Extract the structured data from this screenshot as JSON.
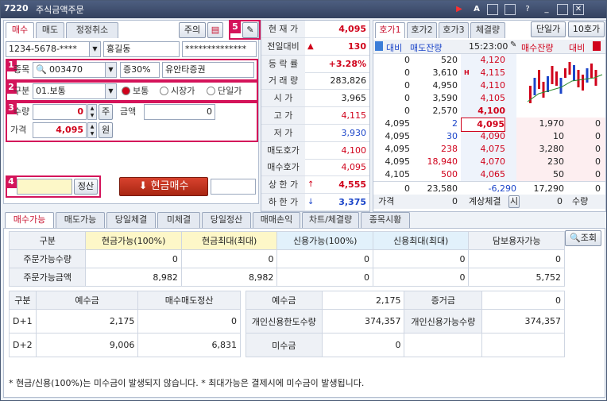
{
  "window": {
    "code": "7220",
    "title": "주식금액주문"
  },
  "left": {
    "tabs": [
      "매수",
      "매도",
      "정정취소"
    ],
    "btn_notice": "주의",
    "account": "1234-5678-****",
    "account_name": "홍길동",
    "password": "**************",
    "stock_label": "종목",
    "stock_code": "003470",
    "margin": "증30%",
    "stock_name": "유안타증권",
    "type_label": "구분",
    "order_type": "01.보통",
    "radio": [
      "보통",
      "시장가",
      "단일가"
    ],
    "qty_label": "수량",
    "qty": "0",
    "qty_btn": "주",
    "amt_label": "금액",
    "amt": "0",
    "price_label": "가격",
    "price": "4,095",
    "price_btn": "원",
    "calc_btn": "정산",
    "buy_btn": "현금매수",
    "markers": [
      "1",
      "2",
      "3",
      "4",
      "5"
    ]
  },
  "quote": [
    {
      "k": "현 재 가",
      "v": "4,095"
    },
    {
      "k": "전일대비",
      "v": "130",
      "arrow": "▲"
    },
    {
      "k": "등 락 률",
      "v": "+3.28%"
    },
    {
      "k": "거 래 량",
      "v": "283,826"
    },
    {
      "k": "시    가",
      "v": "3,965"
    },
    {
      "k": "고    가",
      "v": "4,115"
    },
    {
      "k": "저    가",
      "v": "3,930"
    },
    {
      "k": "매도호가",
      "v": "4,100"
    },
    {
      "k": "매수호가",
      "v": "4,095"
    },
    {
      "k": "상 한 가",
      "v": "4,555",
      "arrow": "↑"
    },
    {
      "k": "하 한 가",
      "v": "3,375",
      "arrow": "↓"
    }
  ],
  "orderbook": {
    "tabs": [
      "호가1",
      "호가2",
      "호가3",
      "체결량"
    ],
    "btn_single": "단일가",
    "btn_10": "10호가",
    "hdr_compare": "대비",
    "hdr_ask": "매도잔량",
    "time": "15:23:00",
    "hdr_bid": "매수잔량",
    "hdr_compare2": "대비",
    "asks": [
      {
        "c": "0",
        "q": "520",
        "p": "4,120"
      },
      {
        "c": "0",
        "q": "3,610",
        "p": "4,115",
        "mark": "H"
      },
      {
        "c": "0",
        "q": "4,950",
        "p": "4,110"
      },
      {
        "c": "0",
        "q": "3,590",
        "p": "4,105"
      },
      {
        "c": "0",
        "q": "2,570",
        "p": "4,100"
      }
    ],
    "bids": [
      {
        "t": "4,095",
        "tq": "2",
        "p": "4,095",
        "q": "1,970",
        "c": "0"
      },
      {
        "t": "4,095",
        "tq": "30",
        "p": "4,090",
        "q": "10",
        "c": "0"
      },
      {
        "t": "4,095",
        "tq": "238",
        "p": "4,075",
        "q": "3,280",
        "c": "0"
      },
      {
        "t": "4,095",
        "tq": "18,940",
        "p": "4,070",
        "q": "230",
        "c": "0"
      },
      {
        "t": "4,105",
        "tq": "500",
        "p": "4,065",
        "q": "50",
        "c": "0"
      }
    ],
    "totals": {
      "c1": "0",
      "ask": "23,580",
      "diff": "-6,290",
      "bid": "17,290",
      "c2": "0"
    },
    "foot": {
      "price_label": "가격",
      "price": "0",
      "exp": "계상체결",
      "exp_btn": "시",
      "qty": "0",
      "qty_label": "수량"
    }
  },
  "bottom": {
    "tabs": [
      "매수가능",
      "매도가능",
      "당일체결",
      "미체결",
      "당일정산",
      "매매손익",
      "차트/체결량",
      "종목시황"
    ],
    "btn_search": "조회",
    "t1_head": [
      "구분",
      "현금가능(100%)",
      "현금최대(최대)",
      "신용가능(100%)",
      "신용최대(최대)",
      "담보용자가능"
    ],
    "t1_rows": [
      {
        "label": "주문가능수량",
        "v": [
          "0",
          "0",
          "0",
          "0",
          "0"
        ]
      },
      {
        "label": "주문가능금액",
        "v": [
          "8,982",
          "8,982",
          "0",
          "0",
          "5,752"
        ]
      }
    ],
    "t2_head": [
      "구분",
      "예수금",
      "매수매도정산"
    ],
    "t2_rows": [
      {
        "label": "D+1",
        "v": [
          "2,175",
          "0"
        ]
      },
      {
        "label": "D+2",
        "v": [
          "9,006",
          "6,831"
        ]
      }
    ],
    "t3": [
      {
        "k1": "예수금",
        "v1": "2,175",
        "k2": "증거금",
        "v2": "0"
      },
      {
        "k1": "개인신용한도수량",
        "v1": "374,357",
        "k2": "개인신용가능수량",
        "v2": "374,357"
      },
      {
        "k1": "미수금",
        "v1": "0",
        "k2": "",
        "v2": ""
      }
    ],
    "note": "* 현금/신용(100%)는 미수금이 발생되지 않습니다. * 최대가능은 결제시에 미수금이 발생됩니다."
  },
  "colors": {
    "accent": "#d4145a",
    "up": "#d0021b",
    "down": "#1b45c9"
  }
}
